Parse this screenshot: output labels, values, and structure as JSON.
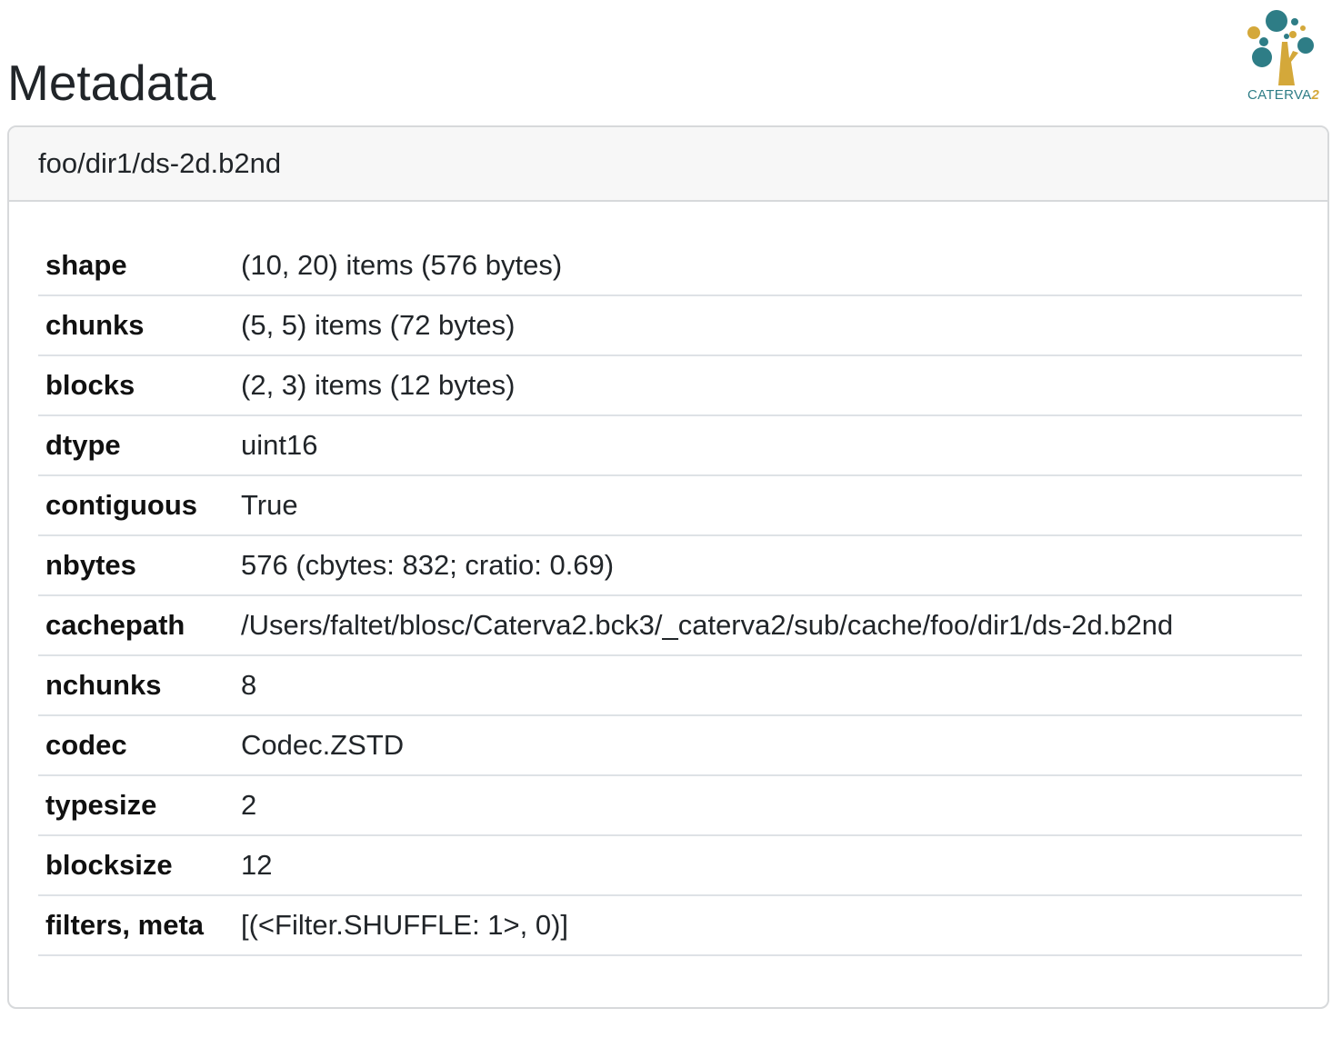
{
  "page": {
    "title": "Metadata"
  },
  "logo": {
    "name": "CATERVA",
    "suffix": "2"
  },
  "card": {
    "header": "foo/dir1/ds-2d.b2nd",
    "rows": [
      {
        "key": "shape",
        "value": "(10, 20) items (576 bytes)"
      },
      {
        "key": "chunks",
        "value": "(5, 5) items (72 bytes)"
      },
      {
        "key": "blocks",
        "value": "(2, 3) items (12 bytes)"
      },
      {
        "key": "dtype",
        "value": "uint16"
      },
      {
        "key": "contiguous",
        "value": "True"
      },
      {
        "key": "nbytes",
        "value": "576 (cbytes: 832; cratio: 0.69)"
      },
      {
        "key": "cachepath",
        "value": "/Users/faltet/blosc/Caterva2.bck3/_caterva2/sub/cache/foo/dir1/ds-2d.b2nd"
      },
      {
        "key": "nchunks",
        "value": "8"
      },
      {
        "key": "codec",
        "value": "Codec.ZSTD"
      },
      {
        "key": "typesize",
        "value": "2"
      },
      {
        "key": "blocksize",
        "value": "12"
      },
      {
        "key": "filters, meta",
        "value": "[(<Filter.SHUFFLE: 1>, 0)]"
      }
    ]
  },
  "colors": {
    "logo_teal": "#2e7d86",
    "logo_gold": "#d4a83a"
  }
}
